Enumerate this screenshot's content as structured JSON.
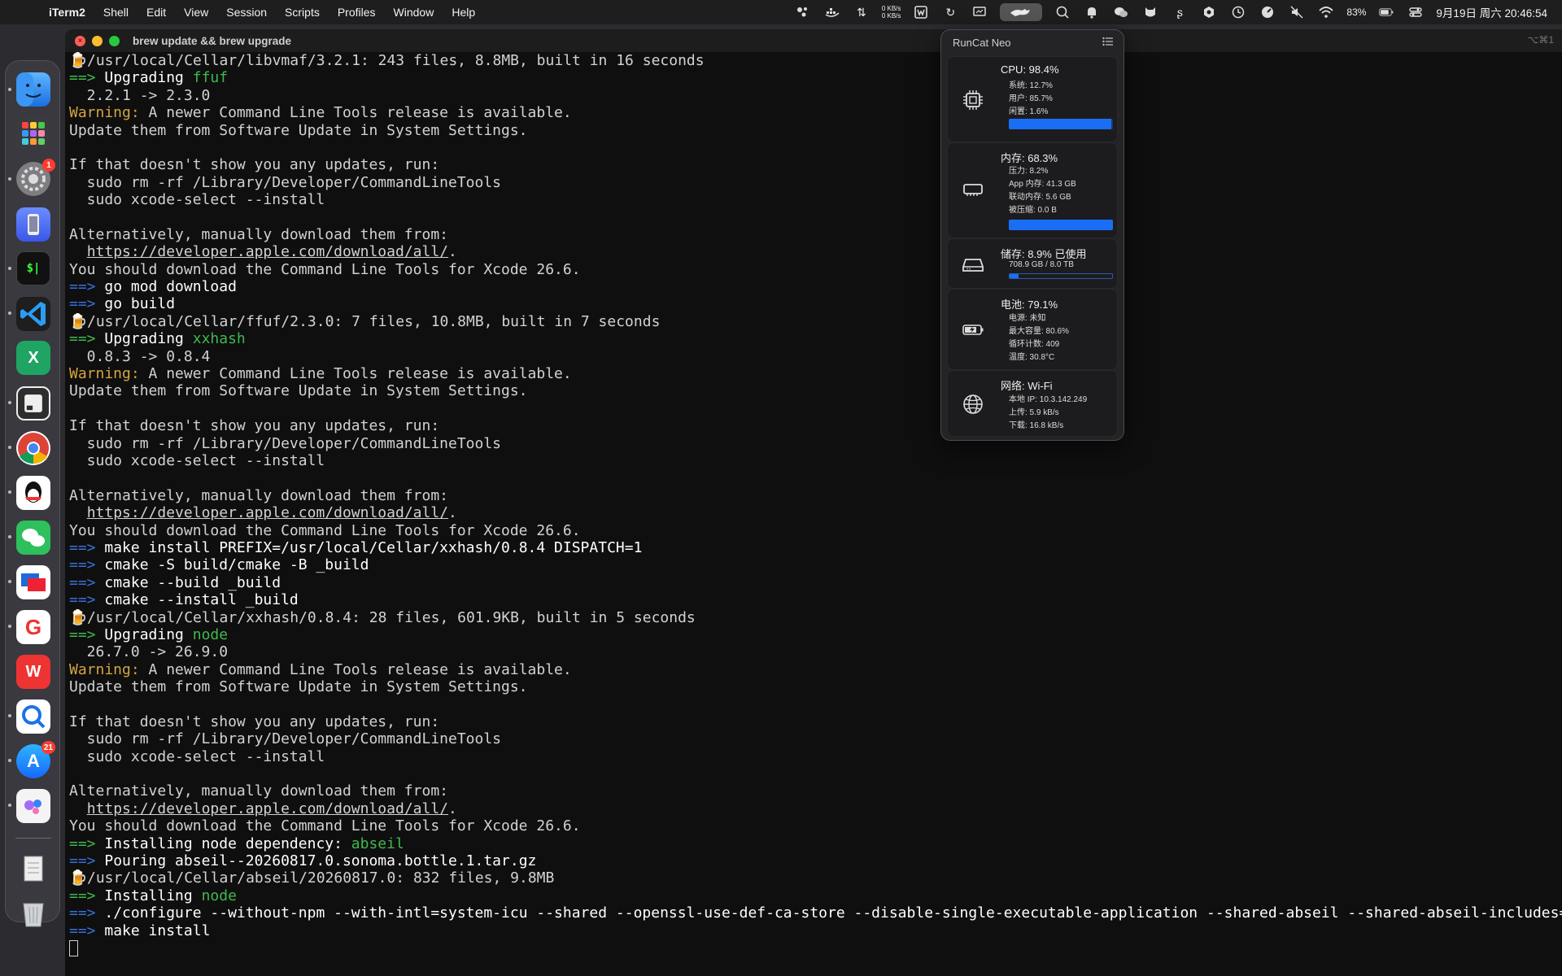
{
  "menubar": {
    "app_name": "iTerm2",
    "items": [
      "Shell",
      "Edit",
      "View",
      "Session",
      "Scripts",
      "Profiles",
      "Window",
      "Help"
    ],
    "net_up": "0 KB/s",
    "net_down": "0 KB/s",
    "battery_percent": "83%",
    "datetime": "9月19日 周六  20:46:54"
  },
  "dock": {
    "badges": {
      "system_settings": "1",
      "app_store": "21"
    }
  },
  "window": {
    "title": "brew update && brew upgrade",
    "shortcut": "⌥⌘1"
  },
  "terminal": {
    "lines": [
      {
        "k": "beer",
        "t": "/usr/local/Cellar/libvmaf/3.2.1: 243 files, 8.8MB, built in 16 seconds"
      },
      {
        "k": "upg",
        "t": "Upgrading ",
        "g": "ffuf"
      },
      {
        "k": "plain",
        "t": "  2.2.1 -> 2.3.0"
      },
      {
        "k": "warn",
        "t": " A newer Command Line Tools release is available."
      },
      {
        "k": "plain",
        "t": "Update them from Software Update in System Settings."
      },
      {
        "k": "plain",
        "t": ""
      },
      {
        "k": "plain",
        "t": "If that doesn't show you any updates, run:"
      },
      {
        "k": "plain",
        "t": "  sudo rm -rf /Library/Developer/CommandLineTools"
      },
      {
        "k": "plain",
        "t": "  sudo xcode-select --install"
      },
      {
        "k": "plain",
        "t": ""
      },
      {
        "k": "plain",
        "t": "Alternatively, manually download them from:"
      },
      {
        "k": "url",
        "t": "https://developer.apple.com/download/all/"
      },
      {
        "k": "plain",
        "t": "You should download the Command Line Tools for Xcode 26.6."
      },
      {
        "k": "blue",
        "t": "go mod download"
      },
      {
        "k": "blue",
        "t": "go build"
      },
      {
        "k": "beer",
        "t": "/usr/local/Cellar/ffuf/2.3.0: 7 files, 10.8MB, built in 7 seconds"
      },
      {
        "k": "upg",
        "t": "Upgrading ",
        "g": "xxhash"
      },
      {
        "k": "plain",
        "t": "  0.8.3 -> 0.8.4"
      },
      {
        "k": "warn",
        "t": " A newer Command Line Tools release is available."
      },
      {
        "k": "plain",
        "t": "Update them from Software Update in System Settings."
      },
      {
        "k": "plain",
        "t": ""
      },
      {
        "k": "plain",
        "t": "If that doesn't show you any updates, run:"
      },
      {
        "k": "plain",
        "t": "  sudo rm -rf /Library/Developer/CommandLineTools"
      },
      {
        "k": "plain",
        "t": "  sudo xcode-select --install"
      },
      {
        "k": "plain",
        "t": ""
      },
      {
        "k": "plain",
        "t": "Alternatively, manually download them from:"
      },
      {
        "k": "url",
        "t": "https://developer.apple.com/download/all/"
      },
      {
        "k": "plain",
        "t": "You should download the Command Line Tools for Xcode 26.6."
      },
      {
        "k": "blue",
        "t": "make install PREFIX=/usr/local/Cellar/xxhash/0.8.4 DISPATCH=1"
      },
      {
        "k": "blue",
        "t": "cmake -S build/cmake -B _build"
      },
      {
        "k": "blue",
        "t": "cmake --build _build"
      },
      {
        "k": "blue",
        "t": "cmake --install _build"
      },
      {
        "k": "beer",
        "t": "/usr/local/Cellar/xxhash/0.8.4: 28 files, 601.9KB, built in 5 seconds"
      },
      {
        "k": "upg",
        "t": "Upgrading ",
        "g": "node"
      },
      {
        "k": "plain",
        "t": "  26.7.0 -> 26.9.0"
      },
      {
        "k": "warn",
        "t": " A newer Command Line Tools release is available."
      },
      {
        "k": "plain",
        "t": "Update them from Software Update in System Settings."
      },
      {
        "k": "plain",
        "t": ""
      },
      {
        "k": "plain",
        "t": "If that doesn't show you any updates, run:"
      },
      {
        "k": "plain",
        "t": "  sudo rm -rf /Library/Developer/CommandLineTools"
      },
      {
        "k": "plain",
        "t": "  sudo xcode-select --install"
      },
      {
        "k": "plain",
        "t": ""
      },
      {
        "k": "plain",
        "t": "Alternatively, manually download them from:"
      },
      {
        "k": "url",
        "t": "https://developer.apple.com/download/all/"
      },
      {
        "k": "plain",
        "t": "You should download the Command Line Tools for Xcode 26.6."
      },
      {
        "k": "upg",
        "t": "Installing node dependency: ",
        "g": "abseil"
      },
      {
        "k": "blue",
        "t": "Pouring abseil--20260817.0.sonoma.bottle.1.tar.gz"
      },
      {
        "k": "beer",
        "t": "/usr/local/Cellar/abseil/20260817.0: 832 files, 9.8MB"
      },
      {
        "k": "upg",
        "t": "Installing ",
        "g": "node"
      },
      {
        "k": "blue",
        "t": "./configure --without-npm --with-intl=system-icu --shared --openssl-use-def-ca-store --disable-single-executable-application --shared-abseil --shared-abseil-includes="
      },
      {
        "k": "blue",
        "t": "make install"
      },
      {
        "k": "cursor",
        "t": ""
      }
    ],
    "arrow": "==>",
    "warning_label": "Warning:",
    "url_suffix": "."
  },
  "runcat": {
    "title": "RunCat Neo",
    "cpu": {
      "title": "CPU:  98.4%",
      "lines": [
        "系统:  12.7%",
        "用户:  85.7%",
        "闲置:  1.6%"
      ],
      "usage_fraction": 0.984
    },
    "memory": {
      "title": "内存:  68.3%",
      "lines": [
        "压力:  8.2%",
        "App 内存:  41.3 GB",
        "联动内存:  5.6 GB",
        "被压缩:  0.0 B"
      ],
      "usage_fraction": 0.683
    },
    "storage": {
      "title": "储存:  8.9% 已使用",
      "lines": [
        "708.9 GB /  8.0 TB"
      ],
      "usage_fraction": 0.089
    },
    "battery": {
      "title": "电池:  79.1%",
      "lines": [
        "电源:  未知",
        "最大容量:  80.6%",
        "循环计数:  409",
        "温度:  30.8°C"
      ]
    },
    "network": {
      "title": "网络:  Wi-Fi",
      "lines": [
        "本地 IP:  10.3.142.249",
        "上传:  5.9 kB/s",
        "下载:  16.8 kB/s"
      ]
    }
  }
}
